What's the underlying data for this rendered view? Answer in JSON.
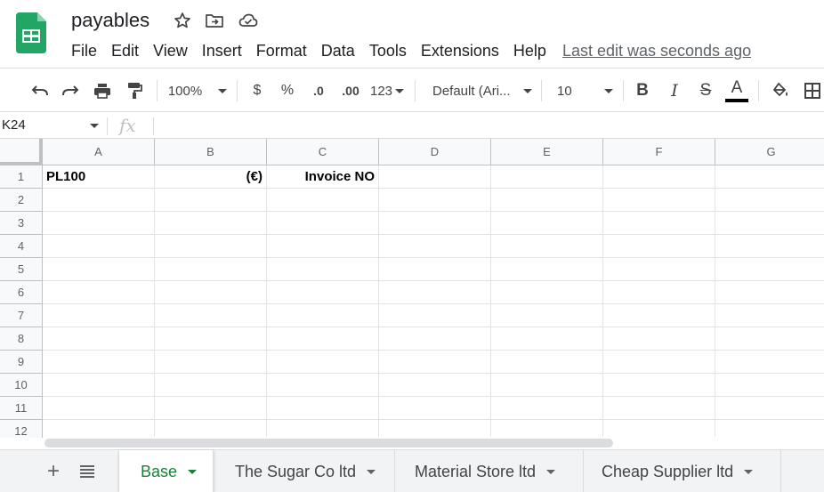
{
  "app": {
    "doc_title": "payables",
    "icons": {
      "logo": "google-sheets-logo",
      "star": "star-icon",
      "move": "folder-move-icon",
      "status": "cloud-saved-icon"
    },
    "accent": "#188038"
  },
  "menu": [
    "File",
    "Edit",
    "View",
    "Insert",
    "Format",
    "Data",
    "Tools",
    "Extensions",
    "Help"
  ],
  "last_edit": "Last edit was seconds ago",
  "toolbar": {
    "zoom": "100%",
    "currency": "$",
    "percent": "%",
    "dec_decrease": ".0",
    "dec_increase": ".00",
    "more_formats": "123",
    "font": "Default (Ari...",
    "font_size": "10",
    "bold": "B",
    "italic": "I",
    "strike": "S",
    "text_color_letter": "A",
    "text_color": "#000000"
  },
  "formula_bar": {
    "name_box": "K24",
    "fx": "fx",
    "formula": ""
  },
  "grid": {
    "columns": [
      "A",
      "B",
      "C",
      "D",
      "E",
      "F",
      "G"
    ],
    "rows": [
      "1",
      "2",
      "3",
      "4",
      "5",
      "6",
      "7",
      "8",
      "9",
      "10",
      "11",
      "12"
    ],
    "cells": {
      "A1": "PL100",
      "B1": "(€)",
      "C1": "Invoice NO"
    }
  },
  "sheets": {
    "add": "+",
    "tabs": [
      {
        "label": "Base",
        "active": true
      },
      {
        "label": "The Sugar Co ltd",
        "active": false
      },
      {
        "label": "Material Store ltd",
        "active": false
      },
      {
        "label": "Cheap Supplier ltd",
        "active": false
      }
    ]
  }
}
